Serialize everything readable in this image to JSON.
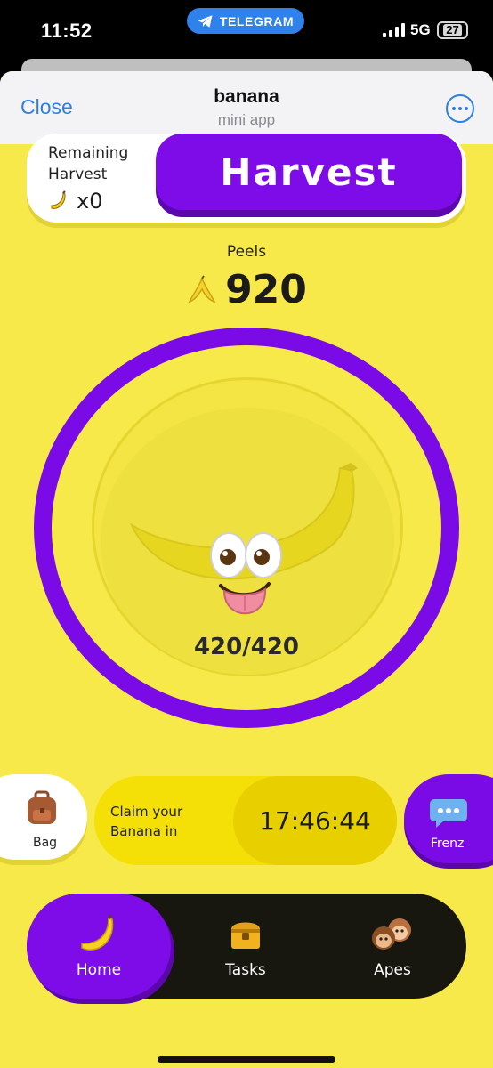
{
  "status_bar": {
    "time": "11:52",
    "pill_label": "TELEGRAM",
    "network": "5G",
    "battery": "27"
  },
  "header": {
    "close_label": "Close",
    "title": "banana",
    "subtitle": "mini app"
  },
  "harvest": {
    "remaining_label_line1": "Remaining",
    "remaining_label_line2": "Harvest",
    "remaining_count": "x0",
    "button_label": "Harvest"
  },
  "peels": {
    "label": "Peels",
    "value": "920"
  },
  "energy": {
    "text": "420/420"
  },
  "bag": {
    "label": "Bag"
  },
  "claim": {
    "line1": "Claim your",
    "line2": "Banana in",
    "timer": "17:46:44"
  },
  "frenz": {
    "label": "Frenz"
  },
  "nav": {
    "items": [
      {
        "label": "Home"
      },
      {
        "label": "Tasks"
      },
      {
        "label": "Apes"
      }
    ]
  },
  "colors": {
    "background": "#f7e94a",
    "accent": "#7a0ae6",
    "nav_bg": "#17160f",
    "link": "#2f80de"
  },
  "icons": [
    "telegram-icon",
    "signal-icon",
    "battery-icon",
    "more-icon",
    "banana-icon",
    "peel-icon",
    "backpack-icon",
    "chat-bubble-icon",
    "treasure-chest-icon",
    "monkeys-icon"
  ]
}
